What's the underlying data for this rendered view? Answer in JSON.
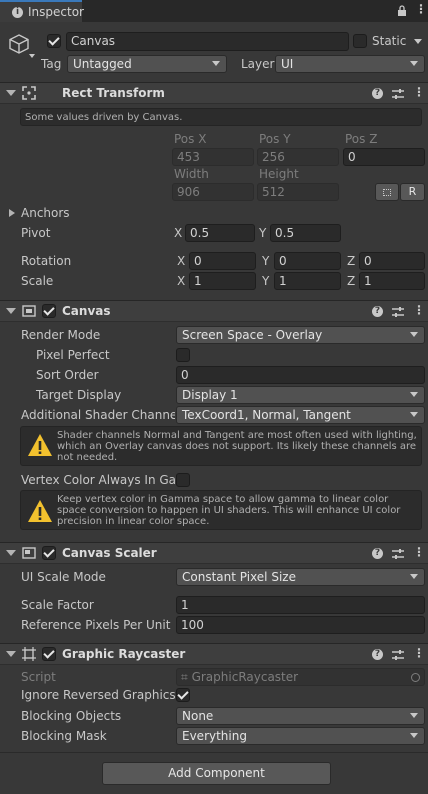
{
  "tab": {
    "title": "Inspector",
    "icon": "info-icon"
  },
  "object": {
    "name": "Canvas",
    "active": true,
    "static_label": "Static",
    "static": false,
    "tag_label": "Tag",
    "tag_value": "Untagged",
    "layer_label": "Layer",
    "layer_value": "UI"
  },
  "rect_transform": {
    "title": "Rect Transform",
    "driven_note": "Some values driven by Canvas.",
    "pos_x_label": "Pos X",
    "pos_x": "453",
    "pos_y_label": "Pos Y",
    "pos_y": "256",
    "pos_z_label": "Pos Z",
    "pos_z": "0",
    "width_label": "Width",
    "width": "906",
    "height_label": "Height",
    "height": "512",
    "r_label": "R",
    "anchors_label": "Anchors",
    "pivot_label": "Pivot",
    "pivot_x": "0.5",
    "pivot_y": "0.5",
    "rotation_label": "Rotation",
    "rot_x": "0",
    "rot_y": "0",
    "rot_z": "0",
    "scale_label": "Scale",
    "scale_x": "1",
    "scale_y": "1",
    "scale_z": "1",
    "x": "X",
    "y": "Y",
    "z": "Z"
  },
  "canvas": {
    "title": "Canvas",
    "enabled": true,
    "render_mode_label": "Render Mode",
    "render_mode": "Screen Space - Overlay",
    "pixel_perfect_label": "Pixel Perfect",
    "pixel_perfect": false,
    "sort_order_label": "Sort Order",
    "sort_order": "0",
    "target_display_label": "Target Display",
    "target_display": "Display 1",
    "shader_channels_label": "Additional Shader Channels",
    "shader_channels": "TexCoord1, Normal, Tangent",
    "warning1": "Shader channels Normal and Tangent are most often used with lighting, which an Overlay canvas does not support. Its likely these channels are not needed.",
    "vertex_color_label": "Vertex Color Always In Gamma",
    "vertex_color": false,
    "warning2": "Keep vertex color in Gamma space to allow gamma to linear color space conversion to happen in UI shaders. This will enhance UI color precision in linear color space."
  },
  "canvas_scaler": {
    "title": "Canvas Scaler",
    "enabled": true,
    "ui_scale_mode_label": "UI Scale Mode",
    "ui_scale_mode": "Constant Pixel Size",
    "scale_factor_label": "Scale Factor",
    "scale_factor": "1",
    "ref_pixels_label": "Reference Pixels Per Unit",
    "ref_pixels": "100"
  },
  "graphic_raycaster": {
    "title": "Graphic Raycaster",
    "enabled": true,
    "script_label": "Script",
    "script": "GraphicRaycaster",
    "ignore_reversed_label": "Ignore Reversed Graphics",
    "ignore_reversed": true,
    "blocking_objects_label": "Blocking Objects",
    "blocking_objects": "None",
    "blocking_mask_label": "Blocking Mask",
    "blocking_mask": "Everything"
  },
  "add_component_label": "Add Component",
  "colors": {
    "accent": "#3a79bb",
    "panel": "#383838",
    "header": "#3e3e3e",
    "warning": "#f2c12e"
  }
}
